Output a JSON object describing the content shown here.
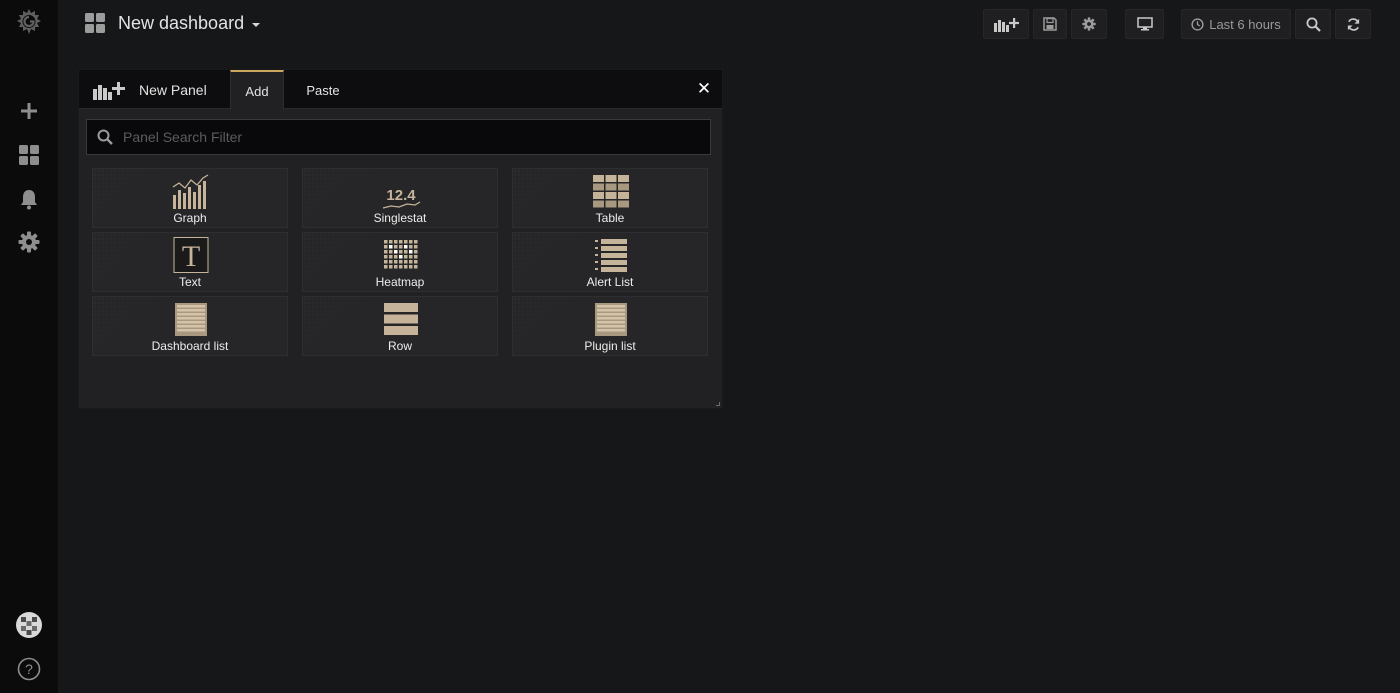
{
  "app": {
    "dashboard_title": "New dashboard"
  },
  "sidebar": {
    "items": [
      {
        "icon": "grafana-logo-icon"
      },
      {
        "icon": "plus-icon"
      },
      {
        "icon": "dashboards-grid-icon"
      },
      {
        "icon": "bell-icon"
      },
      {
        "icon": "gear-icon"
      },
      {
        "icon": "user-avatar"
      },
      {
        "icon": "help-icon"
      }
    ]
  },
  "toolbar": {
    "time_range_label": "Last 6 hours",
    "icons": [
      "add-panel-icon",
      "save-icon",
      "settings-icon",
      "tv-mode-icon",
      "clock-icon",
      "zoom-out-icon",
      "refresh-icon"
    ]
  },
  "panel": {
    "title": "New Panel",
    "tabs": [
      {
        "label": "Add",
        "active": true
      },
      {
        "label": "Paste",
        "active": false
      }
    ],
    "search": {
      "placeholder": "Panel Search Filter",
      "value": ""
    },
    "cards": [
      {
        "label": "Graph",
        "icon": "graph-icon"
      },
      {
        "label": "Singlestat",
        "icon": "singlestat-icon",
        "icon_text": "12.4"
      },
      {
        "label": "Table",
        "icon": "table-icon"
      },
      {
        "label": "Text",
        "icon": "text-icon",
        "icon_text": "T"
      },
      {
        "label": "Heatmap",
        "icon": "heatmap-icon"
      },
      {
        "label": "Alert List",
        "icon": "alert-list-icon"
      },
      {
        "label": "Dashboard list",
        "icon": "dashboard-list-icon"
      },
      {
        "label": "Row",
        "icon": "row-icon"
      },
      {
        "label": "Plugin list",
        "icon": "plugin-list-icon"
      }
    ]
  },
  "colors": {
    "accent": "#c9a75c",
    "icon_tan": "#c6b49a",
    "background": "#161719",
    "sidebar": "#0b0b0c"
  }
}
